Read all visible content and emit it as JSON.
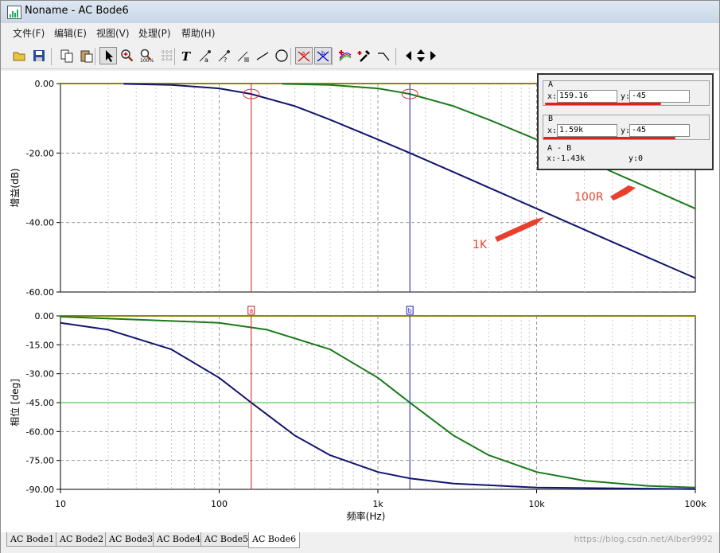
{
  "window": {
    "title": "Noname - AC Bode6"
  },
  "menu": [
    "文件(F)",
    "编辑(E)",
    "视图(V)",
    "处理(P)",
    "帮助(H)"
  ],
  "toolbar": [
    {
      "name": "open-icon"
    },
    {
      "name": "save-icon"
    },
    {
      "name": "copy-icon"
    },
    {
      "name": "paste-icon"
    },
    {
      "name": "pointer-icon"
    },
    {
      "name": "zoom-in-icon"
    },
    {
      "name": "zoom-100-icon"
    },
    {
      "name": "grid-icon"
    },
    {
      "name": "text-icon"
    },
    {
      "name": "label-icon"
    },
    {
      "name": "comment-icon"
    },
    {
      "name": "legend-icon"
    },
    {
      "name": "line-icon"
    },
    {
      "name": "ellipse-icon"
    },
    {
      "name": "cursor-a-icon"
    },
    {
      "name": "cursor-b-icon"
    },
    {
      "name": "curves-icon"
    },
    {
      "name": "probe-icon"
    },
    {
      "name": "step-icon"
    },
    {
      "name": "arrow-left-icon"
    },
    {
      "name": "arrow-updown-icon"
    },
    {
      "name": "arrow-right-icon"
    }
  ],
  "cursor_panel": {
    "a": {
      "label": "A",
      "x_label": "x:",
      "x_value": "159.16",
      "y_label": "y:",
      "y_value": "-45"
    },
    "b": {
      "label": "B",
      "x_label": "x:",
      "x_value": "1.59k",
      "y_label": "y:",
      "y_value": "-45"
    },
    "diff": {
      "label": "A - B",
      "x_text": "x:-1.43k",
      "y_text": "y:0"
    }
  },
  "chart_data": [
    {
      "type": "line",
      "ylabel": "增益(dB)",
      "xscale": "log",
      "xlim": [
        10,
        100000
      ],
      "ylim": [
        -60,
        0
      ],
      "yticks": [
        "0.00",
        "-20.00",
        "-40.00",
        "-60.00"
      ],
      "grid": true,
      "series": [
        {
          "name": "1K",
          "color": "#12146e",
          "x": [
            25,
            50,
            100,
            159,
            300,
            500,
            1000,
            1590,
            3000,
            10000,
            30000,
            100000
          ],
          "y": [
            -0.1,
            -0.4,
            -1.4,
            -3.0,
            -6.5,
            -10.4,
            -16.1,
            -20.0,
            -25.5,
            -36.0,
            -45.6,
            -56.0
          ]
        },
        {
          "name": "100R",
          "color": "#1a7a1a",
          "x": [
            250,
            500,
            1000,
            1590,
            3000,
            5000,
            10000,
            20000,
            50000,
            100000
          ],
          "y": [
            -0.1,
            -0.4,
            -1.4,
            -3.0,
            -6.5,
            -10.4,
            -16.1,
            -21.9,
            -29.9,
            -36.0
          ]
        }
      ],
      "annotations": [
        {
          "text": "100R",
          "color": "#e8402c"
        },
        {
          "text": "1K",
          "color": "#e8402c"
        }
      ]
    },
    {
      "type": "line",
      "xlabel": "频率(Hz)",
      "ylabel": "相位 [deg]",
      "xscale": "log",
      "xlim": [
        10,
        100000
      ],
      "ylim": [
        -90,
        0
      ],
      "yticks": [
        "0.00",
        "-15.00",
        "-30.00",
        "-45.00",
        "-60.00",
        "-75.00",
        "-90.00"
      ],
      "xticks": [
        "10",
        "100",
        "1k",
        "10k",
        "100k"
      ],
      "grid": true,
      "hline": -45,
      "series": [
        {
          "name": "1K",
          "color": "#12146e",
          "x": [
            10,
            20,
            50,
            100,
            159.16,
            300,
            500,
            1000,
            1590,
            3000,
            10000,
            100000
          ],
          "y": [
            -3.6,
            -7.2,
            -17.4,
            -32.1,
            -45,
            -62.1,
            -72.3,
            -81.0,
            -84.3,
            -87.0,
            -89.1,
            -89.9
          ]
        },
        {
          "name": "100R",
          "color": "#1a7a1a",
          "x": [
            10,
            100,
            200,
            500,
            1000,
            1590,
            3000,
            5000,
            10000,
            20000,
            50000,
            100000
          ],
          "y": [
            -0.4,
            -3.6,
            -7.2,
            -17.4,
            -32.1,
            -45,
            -62.1,
            -72.3,
            -81.0,
            -85.5,
            -88.2,
            -89.1
          ]
        }
      ]
    }
  ],
  "cursors": [
    {
      "label": "a",
      "x": 159.16,
      "color": "#d01818"
    },
    {
      "label": "b",
      "x": 1590,
      "color": "#1c1cbe"
    }
  ],
  "tabs": [
    "AC Bode1",
    "AC Bode2",
    "AC Bode3",
    "AC Bode4",
    "AC Bode5",
    "AC Bode6"
  ],
  "active_tab": 5,
  "watermark": "https://blog.csdn.net/Alber9992"
}
